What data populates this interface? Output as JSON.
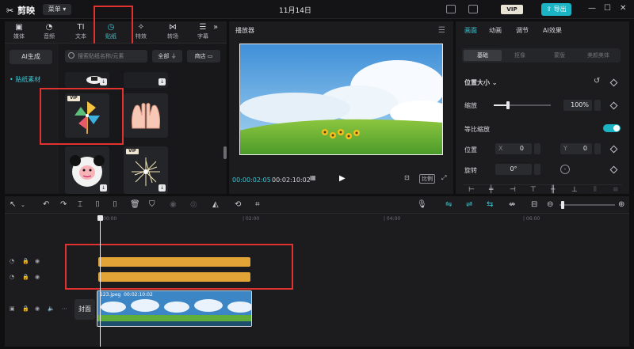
{
  "titlebar": {
    "app_name": "剪映",
    "menu_label": "菜单",
    "date": "11月14日",
    "vip_label": "VIP",
    "export_label": "导出"
  },
  "left_panel": {
    "tabs": [
      {
        "label": "媒体",
        "icon": "media-icon"
      },
      {
        "label": "音频",
        "icon": "audio-icon"
      },
      {
        "label": "文本",
        "icon": "text-icon"
      },
      {
        "label": "贴纸",
        "icon": "sticker-icon",
        "active": true
      },
      {
        "label": "特效",
        "icon": "effects-icon"
      },
      {
        "label": "转场",
        "icon": "transition-icon"
      },
      {
        "label": "字幕",
        "icon": "caption-icon"
      }
    ],
    "ai_generate_label": "AI生成",
    "nav_item_label": "• 贴纸素材",
    "search_placeholder": "搜索贴纸名称/元素",
    "filter_label": "全部",
    "store_label": "商店",
    "vip_tag": "VIP"
  },
  "player": {
    "title": "播放器",
    "current_time": "00:00:02:05",
    "total_time": "00:02:10:02",
    "ratio_label": "比例"
  },
  "properties": {
    "tabs": [
      "画面",
      "动画",
      "调节",
      "AI效果"
    ],
    "subtabs": [
      "基础",
      "抠像",
      "蒙版",
      "美颜美体"
    ],
    "section_title": "位置大小 ⌄",
    "scale_label": "缩放",
    "scale_value": "100%",
    "uniform_scale_label": "等比缩放",
    "position_label": "位置",
    "x_label": "X",
    "x_value": "0",
    "y_label": "Y",
    "y_value": "0",
    "rotation_label": "旋转",
    "rotation_value": "0°"
  },
  "timeline": {
    "ticks": [
      "00:00",
      "| 02:00",
      "| 04:00",
      "| 06:00"
    ],
    "clip_name": "123.jpeg",
    "clip_duration": "00:02:10:02",
    "cover_label": "封面"
  },
  "colors": {
    "accent": "#38c7d4",
    "export_button": "#1bb4c4",
    "sticker_clip": "#e2a436",
    "highlight": "#e2322f"
  }
}
